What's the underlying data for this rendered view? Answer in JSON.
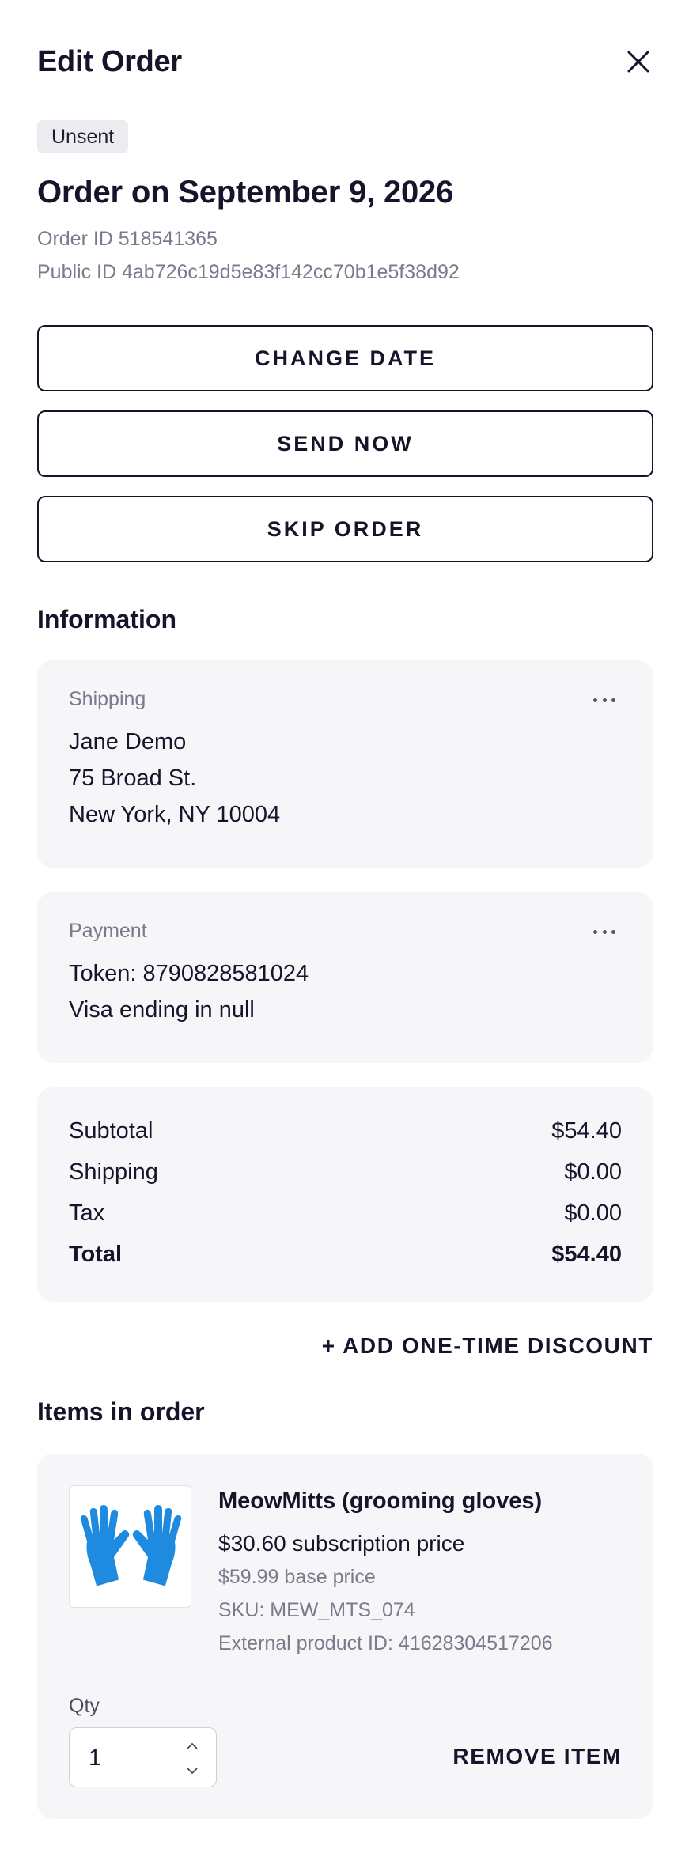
{
  "header": {
    "title": "Edit Order",
    "close_icon": "close-icon"
  },
  "order": {
    "status_badge": "Unsent",
    "title": "Order on September 9, 2026",
    "order_id": "Order ID 518541365",
    "public_id": "Public ID 4ab726c19d5e83f142cc70b1e5f38d92"
  },
  "actions": {
    "change_date": "CHANGE DATE",
    "send_now": "SEND NOW",
    "skip_order": "SKIP ORDER"
  },
  "information": {
    "title": "Information",
    "shipping": {
      "label": "Shipping",
      "name": "Jane Demo",
      "street": "75 Broad St.",
      "city": "New York, NY 10004",
      "menu_icon": "more-horizontal-icon"
    },
    "payment": {
      "label": "Payment",
      "token": "Token: 8790828581024",
      "card": "Visa ending in null",
      "menu_icon": "more-horizontal-icon"
    }
  },
  "summary": {
    "subtotal_label": "Subtotal",
    "subtotal_value": "$54.40",
    "shipping_label": "Shipping",
    "shipping_value": "$0.00",
    "tax_label": "Tax",
    "tax_value": "$0.00",
    "total_label": "Total",
    "total_value": "$54.40"
  },
  "discount_link": "+ ADD ONE-TIME DISCOUNT",
  "items": {
    "title": "Items in order",
    "list": [
      {
        "name": "MeowMitts (grooming gloves)",
        "subscription_price": "$30.60 subscription price",
        "base_price": "$59.99 base price",
        "sku": "SKU: MEW_MTS_074",
        "external_id": "External product ID: 41628304517206",
        "qty_label": "Qty",
        "qty": "1",
        "remove_label": "REMOVE ITEM",
        "image_icon": "grooming-gloves-image"
      }
    ]
  },
  "colors": {
    "text": "#14142b",
    "muted": "#7a7a8c",
    "card_bg": "#f6f6f9",
    "badge_bg": "#ebebf0",
    "glove_blue": "#1e8be0"
  }
}
